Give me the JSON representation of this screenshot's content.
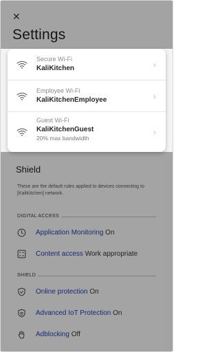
{
  "header": {
    "close_symbol": "✕",
    "title": "Settings"
  },
  "wifi": {
    "networks": [
      {
        "type": "Secure Wi-Fi",
        "name": "KaliKitchen",
        "sub": ""
      },
      {
        "type": "Employee Wi-Fi",
        "name": "KaliKitchenEmployee",
        "sub": ""
      },
      {
        "type": "Guest Wi-Fi",
        "name": "KaliKitchenGuest",
        "sub": "20% max bandwidth"
      }
    ],
    "chevron": "›",
    "icon": "wifi-icon"
  },
  "shield": {
    "title": "Shield",
    "description": "These are the default rules applied to devices connecting to [KaliKitchen] network.",
    "digital_access": {
      "label": "DIGITAL ACCESS",
      "items": [
        {
          "label": "Application Monitoring",
          "state": "On",
          "icon": "clock-icon"
        },
        {
          "label": "Content access",
          "state": "Work appropriate",
          "icon": "content-filter-icon"
        }
      ]
    },
    "shield_section": {
      "label": "SHIELD",
      "items": [
        {
          "label": "Online protection",
          "state": "On",
          "icon": "shield-check-icon"
        },
        {
          "label": "Advanced IoT Protection",
          "state": "On",
          "icon": "iot-shield-icon"
        },
        {
          "label": "Adblocking",
          "state": "Off",
          "icon": "hand-stop-icon"
        }
      ]
    }
  },
  "colors": {
    "link": "#1f3fb0",
    "overlay": "rgba(0,0,0,0.33)"
  }
}
